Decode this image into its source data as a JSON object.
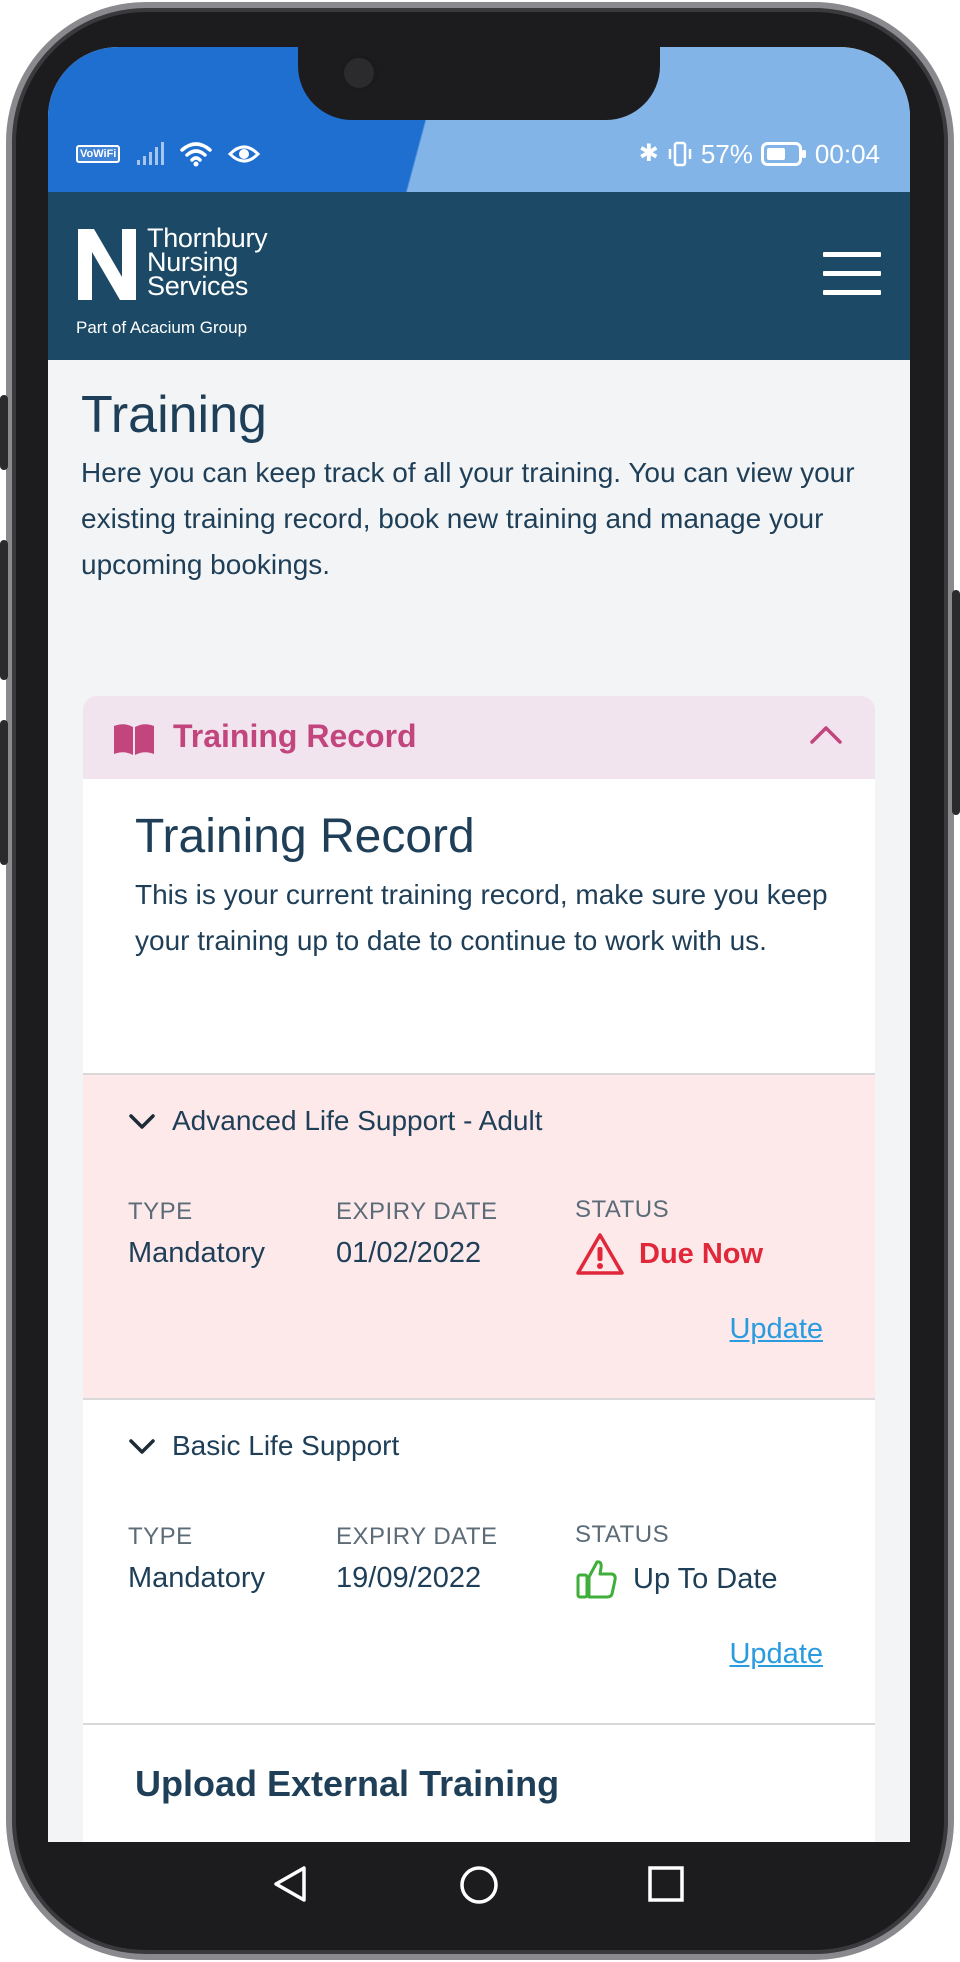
{
  "status_bar": {
    "left_badge": "VoWiFi",
    "battery": "57%",
    "time": "00:04",
    "icons": [
      "vowifi-icon",
      "signal-icon",
      "wifi-icon",
      "eye-icon",
      "bluetooth-icon",
      "vibrate-icon",
      "battery-icon"
    ]
  },
  "header": {
    "logo_letter": "N",
    "logo_line1": "Thornbury",
    "logo_line2": "Nursing",
    "logo_line3": "Services",
    "logo_sub": "Part of Acacium Group",
    "menu_icon": "hamburger-menu-icon",
    "brand_color": "#1c4a66"
  },
  "page": {
    "title": "Training",
    "intro": "Here you can keep track of all your training. You can view your existing training record, book new training and manage your upcoming bookings."
  },
  "accordion": {
    "label": "Training Record",
    "icon": "book-icon",
    "chevron": "chevron-up-icon",
    "accent": "#c2457d"
  },
  "card": {
    "title": "Training Record",
    "description": "This is your current training record, make sure you keep your training up to date to continue to work with us."
  },
  "columns": {
    "type": "TYPE",
    "expiry": "EXPIRY DATE",
    "status": "STATUS"
  },
  "records": [
    {
      "name": "Advanced Life Support - Adult",
      "type": "Mandatory",
      "expiry": "01/02/2022",
      "status": "Due Now",
      "status_icon": "warning-triangle-icon",
      "status_color": "#e0283a",
      "action": "Update"
    },
    {
      "name": "Basic Life Support",
      "type": "Mandatory",
      "expiry": "19/09/2022",
      "status": "Up To Date",
      "status_icon": "thumbs-up-icon",
      "status_color": "#3fae3a",
      "action": "Update"
    }
  ],
  "upload": {
    "title": "Upload External Training"
  }
}
